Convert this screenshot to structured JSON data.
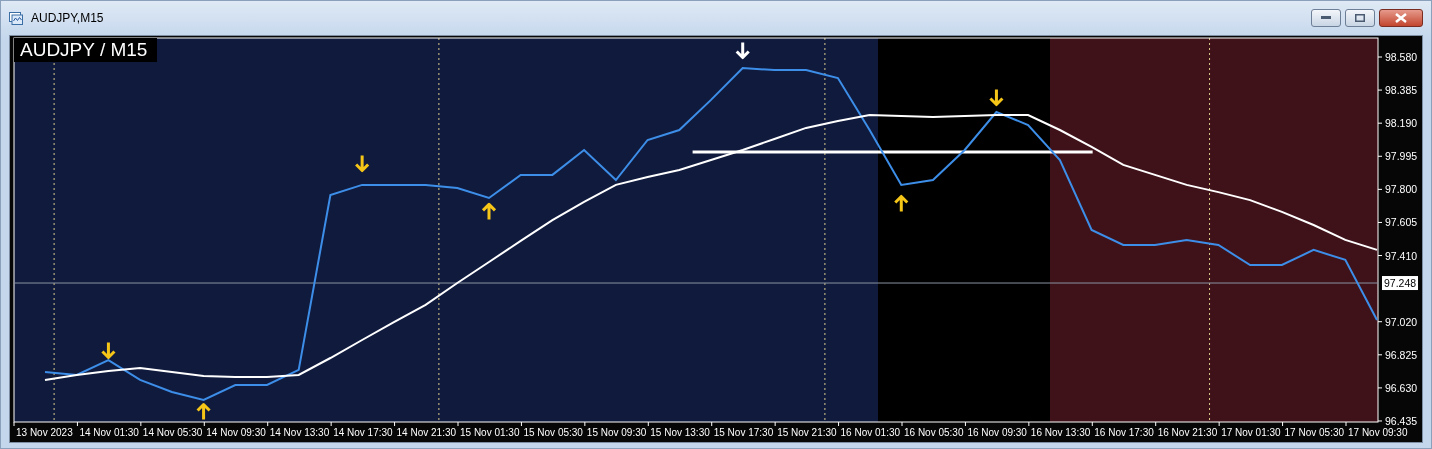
{
  "window": {
    "title": "AUDJPY,M15"
  },
  "chart": {
    "label": "AUDJPY / M15",
    "current_price": {
      "label": "97.248"
    },
    "sessions": [
      {
        "color": "#101a3d"
      },
      {
        "color": "#000000"
      },
      {
        "color": "#3f121a"
      }
    ],
    "chart_data": {
      "type": "line",
      "categories": [
        "13 Nov 2023",
        null,
        "14 Nov 01:30",
        null,
        "14 Nov 05:30",
        null,
        "14 Nov 09:30",
        null,
        "14 Nov 13:30",
        null,
        "14 Nov 17:30",
        null,
        "14 Nov 21:30",
        null,
        "15 Nov 01:30",
        null,
        "15 Nov 05:30",
        null,
        "15 Nov 09:30",
        null,
        "15 Nov 13:30",
        null,
        "15 Nov 17:30",
        null,
        "15 Nov 21:30",
        null,
        "16 Nov 01:30",
        null,
        "16 Nov 05:30",
        null,
        "16 Nov 09:30",
        null,
        "16 Nov 13:30",
        null,
        "16 Nov 17:30",
        null,
        "16 Nov 21:30",
        null,
        "17 Nov 01:30",
        null,
        "17 Nov 05:30",
        null,
        "17 Nov 09:30"
      ],
      "ylim": [
        96.429,
        98.692
      ],
      "yticks": [
        {
          "value": 98.58,
          "label": "98.580"
        },
        {
          "value": 98.385,
          "label": "98.385"
        },
        {
          "value": 98.19,
          "label": "98.190"
        },
        {
          "value": 97.995,
          "label": "97.995"
        },
        {
          "value": 97.8,
          "label": "97.800"
        },
        {
          "value": 97.605,
          "label": "97.605"
        },
        {
          "value": 97.41,
          "label": "97.410"
        },
        {
          "value": 97.02,
          "label": "97.020"
        },
        {
          "value": 96.825,
          "label": "96.825"
        },
        {
          "value": 96.63,
          "label": "96.630"
        },
        {
          "value": 96.435,
          "label": "96.435"
        }
      ],
      "series": [
        {
          "color": "#3d8ee8",
          "values": [
            96.724,
            96.706,
            96.794,
            96.677,
            96.606,
            96.559,
            96.647,
            96.647,
            96.736,
            97.767,
            97.826,
            97.826,
            97.826,
            97.808,
            97.749,
            97.885,
            97.885,
            98.032,
            97.855,
            98.091,
            98.15,
            98.327,
            98.515,
            98.503,
            98.503,
            98.456,
            98.15,
            97.826,
            97.855,
            98.032,
            98.256,
            98.179,
            97.973,
            97.561,
            97.472,
            97.472,
            97.502,
            97.472,
            97.354,
            97.354,
            97.443,
            97.384,
            97.03
          ]
        },
        {
          "color": "#ffffff",
          "values": [
            96.677,
            96.706,
            96.73,
            96.747,
            96.724,
            96.7,
            96.694,
            96.694,
            96.706,
            96.806,
            96.912,
            97.018,
            97.119,
            97.248,
            97.372,
            97.496,
            97.619,
            97.726,
            97.826,
            97.873,
            97.914,
            97.973,
            98.032,
            98.097,
            98.162,
            98.203,
            98.238,
            98.232,
            98.226,
            98.232,
            98.238,
            98.238,
            98.15,
            98.05,
            97.944,
            97.885,
            97.826,
            97.784,
            97.737,
            97.667,
            97.59,
            97.502,
            97.443
          ]
        },
        {
          "color": "#f5c518",
          "marker": "cross",
          "values": [
            null,
            null,
            96.853,
            null,
            null,
            null,
            null,
            null,
            null,
            null,
            97.955,
            null,
            null,
            null,
            null,
            null,
            null,
            null,
            null,
            null,
            null,
            null,
            null,
            null,
            null,
            null,
            null,
            null,
            null,
            null,
            98.344,
            null,
            null,
            null,
            null,
            null,
            null,
            null,
            null,
            null,
            null,
            null,
            null
          ]
        },
        {
          "color": "#f5c518",
          "marker": "cross",
          "values": [
            null,
            null,
            null,
            null,
            null,
            96.488,
            null,
            null,
            null,
            null,
            null,
            null,
            null,
            null,
            97.667,
            null,
            null,
            null,
            null,
            null,
            null,
            null,
            null,
            null,
            null,
            null,
            null,
            97.714,
            null,
            null,
            null,
            null,
            null,
            null,
            null,
            null,
            null,
            null,
            null,
            null,
            null,
            null,
            null
          ]
        },
        {
          "color": "#ffffff",
          "marker": "cross",
          "values": [
            null,
            null,
            null,
            null,
            null,
            null,
            null,
            null,
            null,
            null,
            null,
            null,
            null,
            null,
            null,
            null,
            null,
            null,
            null,
            null,
            null,
            null,
            98.621,
            null,
            null,
            null,
            null,
            null,
            null,
            null,
            null,
            null,
            null,
            null,
            null,
            null,
            null,
            null,
            null,
            null,
            null,
            null,
            null
          ]
        }
      ],
      "ref_lines": [
        {
          "axis": "y",
          "value": 97.248
        },
        {
          "axis": "y",
          "value": 98.02
        }
      ]
    }
  }
}
